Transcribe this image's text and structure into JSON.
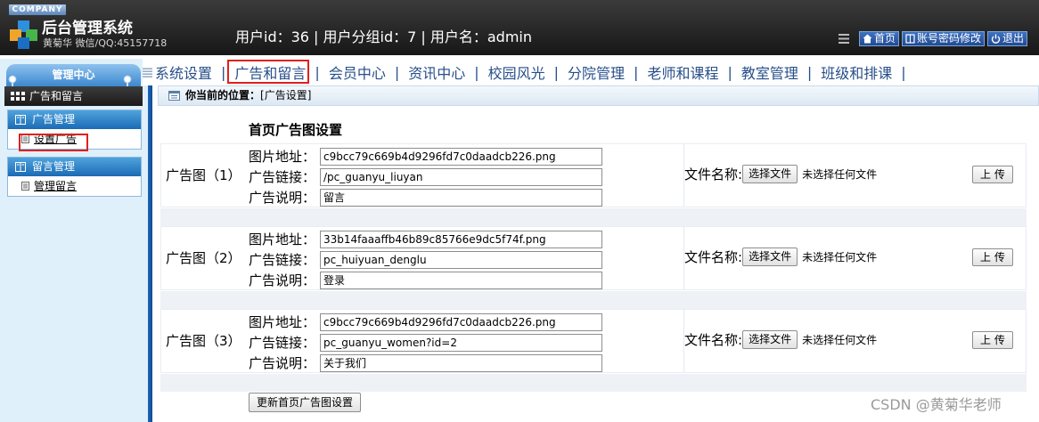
{
  "header": {
    "company": "COMPANY",
    "title": "后台管理系统",
    "subtitle": "黄菊华 微信/QQ:45157718",
    "user_info": "用户id：36 | 用户分组id：7 | 用户名：admin",
    "links": [
      {
        "label": "首页",
        "icon": "home-icon"
      },
      {
        "label": "账号密码修改",
        "icon": "book-icon"
      },
      {
        "label": "退出",
        "icon": "power-icon"
      }
    ]
  },
  "sidebar": {
    "tab_label": "管理中心",
    "section_label": "广告和留言",
    "groups": [
      {
        "label": "广告管理",
        "item": "设置广告"
      },
      {
        "label": "留言管理",
        "item": "管理留言"
      }
    ]
  },
  "nav": {
    "items": [
      "系统设置",
      "广告和留言",
      "会员中心",
      "资讯中心",
      "校园风光",
      "分院管理",
      "老师和课程",
      "教室管理",
      "班级和排课"
    ],
    "active_index": 1
  },
  "breadcrumb": {
    "label": "你当前的位置：",
    "value": "[广告设置]"
  },
  "page": {
    "title": "首页广告图设置",
    "labels": {
      "image_url": "图片地址：",
      "link": "广告链接：",
      "desc": "广告说明：",
      "file_name": "文件名称:",
      "choose_file": "选择文件",
      "no_file": "未选择任何文件",
      "upload": "上 传"
    },
    "ads": [
      {
        "label": "广告图（1）",
        "image": "c9bcc79c669b4d9296fd7c0daadcb226.png",
        "link": "/pc_guanyu_liuyan",
        "desc": "留言"
      },
      {
        "label": "广告图（2）",
        "image": "33b14faaaffb46b89c85766e9dc5f74f.png",
        "link": "pc_huiyuan_denglu",
        "desc": "登录"
      },
      {
        "label": "广告图（3）",
        "image": "c9bcc79c669b4d9296fd7c0daadcb226.png",
        "link": "pc_guanyu_women?id=2",
        "desc": "关于我们"
      }
    ],
    "update_button": "更新首页广告图设置"
  },
  "watermark": "CSDN @黄菊华老师",
  "colors": {
    "header_bg": "#1f1f1f",
    "accent_blue": "#1b6bb5",
    "highlight_red": "#e0201e",
    "nav_text": "#274f8a"
  }
}
